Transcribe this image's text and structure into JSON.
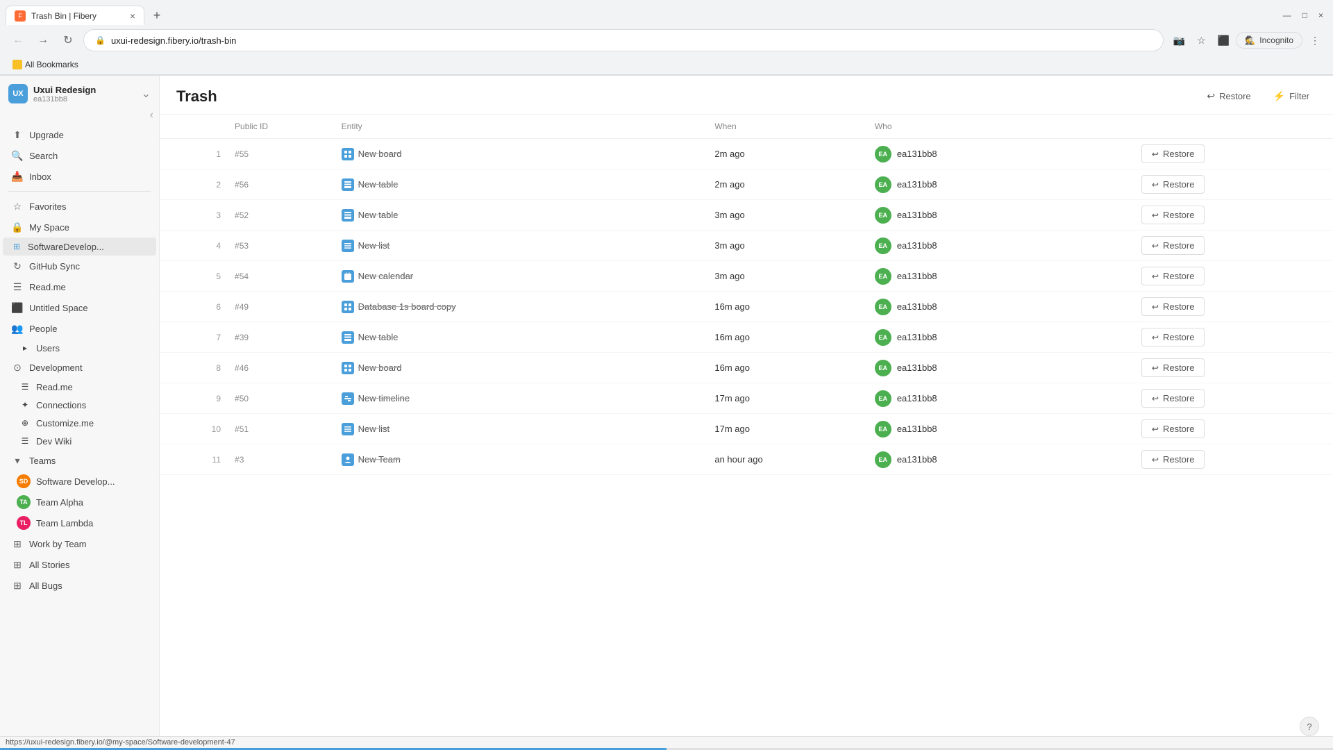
{
  "browser": {
    "tab_title": "Trash Bin | Fibery",
    "url": "uxui-redesign.fibery.io/trash-bin",
    "new_tab_label": "+",
    "incognito_label": "Incognito",
    "bookmarks_label": "All Bookmarks"
  },
  "workspace": {
    "name": "Uxui Redesign",
    "id": "ea131bb8",
    "initials": "UX"
  },
  "sidebar": {
    "upgrade_label": "Upgrade",
    "search_label": "Search",
    "inbox_label": "Inbox",
    "favorites_label": "Favorites",
    "my_space_label": "My Space",
    "software_dev_label": "SoftwareDevelop...",
    "github_sync_label": "GitHub Sync",
    "read_me_1_label": "Read.me",
    "untitled_space_label": "Untitled Space",
    "people_label": "People",
    "users_label": "Users",
    "development_label": "Development",
    "read_me_2_label": "Read.me",
    "connections_label": "Connections",
    "customize_me_label": "Customize.me",
    "dev_wiki_label": "Dev Wiki",
    "teams_label": "Teams",
    "team_software_label": "Software Develop...",
    "team_alpha_label": "Team Alpha",
    "team_lambda_label": "Team Lambda",
    "work_by_team_label": "Work by Team",
    "all_stories_label": "All Stories",
    "all_bugs_label": "All Bugs"
  },
  "main": {
    "page_title": "Trash",
    "restore_all_label": "Restore",
    "filter_label": "Filter"
  },
  "table": {
    "columns": {
      "num": "",
      "public_id": "Public ID",
      "entity": "Entity",
      "when": "When",
      "who": "Who",
      "action": ""
    },
    "rows": [
      {
        "num": 1,
        "id": "#55",
        "entity": "New board",
        "entity_type": "board",
        "when": "2m ago",
        "who": "ea131bb8"
      },
      {
        "num": 2,
        "id": "#56",
        "entity": "New table",
        "entity_type": "table",
        "when": "2m ago",
        "who": "ea131bb8"
      },
      {
        "num": 3,
        "id": "#52",
        "entity": "New table",
        "entity_type": "table",
        "when": "3m ago",
        "who": "ea131bb8"
      },
      {
        "num": 4,
        "id": "#53",
        "entity": "New list",
        "entity_type": "list",
        "when": "3m ago",
        "who": "ea131bb8"
      },
      {
        "num": 5,
        "id": "#54",
        "entity": "New calendar",
        "entity_type": "calendar",
        "when": "3m ago",
        "who": "ea131bb8"
      },
      {
        "num": 6,
        "id": "#49",
        "entity": "Database 1s board copy",
        "entity_type": "board",
        "when": "16m ago",
        "who": "ea131bb8"
      },
      {
        "num": 7,
        "id": "#39",
        "entity": "New table",
        "entity_type": "table",
        "when": "16m ago",
        "who": "ea131bb8"
      },
      {
        "num": 8,
        "id": "#46",
        "entity": "New board",
        "entity_type": "board",
        "when": "16m ago",
        "who": "ea131bb8"
      },
      {
        "num": 9,
        "id": "#50",
        "entity": "New timeline",
        "entity_type": "timeline",
        "when": "17m ago",
        "who": "ea131bb8"
      },
      {
        "num": 10,
        "id": "#51",
        "entity": "New list",
        "entity_type": "list",
        "when": "17m ago",
        "who": "ea131bb8"
      },
      {
        "num": 11,
        "id": "#3",
        "entity": "New Team",
        "entity_type": "team",
        "when": "an hour ago",
        "who": "ea131bb8"
      }
    ],
    "restore_label": "Restore"
  },
  "status_bar": {
    "url": "https://uxui-redesign.fibery.io/@my-space/Software-development-47"
  },
  "help": "?"
}
